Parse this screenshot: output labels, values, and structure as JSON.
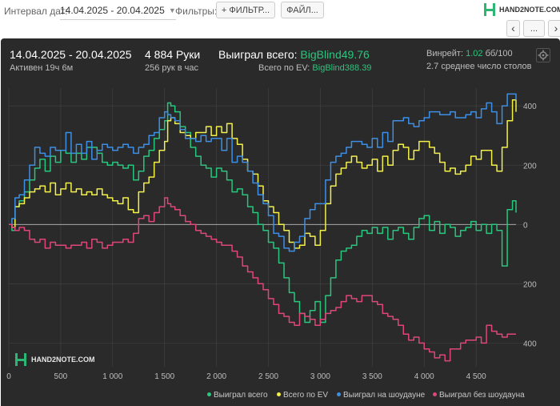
{
  "toolbar": {
    "interval_label": "Интервал дат:",
    "interval_value": "14.04.2025 - 20.04.2025",
    "filters_label": "Фильтры:",
    "filter_button": "+ ФИЛЬТР...",
    "file_button": "ФАЙЛ...",
    "back_button": "‹",
    "more_button": "...",
    "logo_text": "HAND2NOTE.COM"
  },
  "summary": {
    "range": "14.04.2025 - 20.04.2025",
    "active": "Активен 19ч 6м",
    "hands": "4 884 Руки",
    "hands_per_hour": "256 рук в час",
    "won_label": "Выиграл всего:",
    "won_value": "BigBlind49.76",
    "ev_label": "Всего по EV:",
    "ev_value": "BigBlind388.39",
    "winrate_label": "Винрейт:",
    "winrate_value": "1.02",
    "winrate_unit": "бб/100",
    "tables": "2.7 среднее число столов"
  },
  "colors": {
    "won": "#27c77d",
    "ev": "#f3f04a",
    "showdown": "#3d8fe6",
    "non_showdown": "#e0457b",
    "zero_line": "#bbbbbb",
    "grid": "#444444"
  },
  "chart_data": {
    "type": "line",
    "xlabel": "",
    "ylabel": "",
    "xlim": [
      0,
      4884
    ],
    "ylim": [
      -480,
      460
    ],
    "xticks": [
      0,
      500,
      1000,
      1500,
      2000,
      2500,
      3000,
      3500,
      4000,
      4500
    ],
    "xtick_labels": [
      "0",
      "500",
      "1 000",
      "1 500",
      "2 000",
      "2 500",
      "3 000",
      "3 500",
      "4 000",
      "4 500"
    ],
    "yticks": [
      400,
      200,
      0,
      -200,
      -400
    ],
    "ytick_labels": [
      "400",
      "200",
      "0",
      "200",
      "400"
    ],
    "grid": true,
    "legend": "bottom-right",
    "series": [
      {
        "name": "Выиграл всего",
        "key": "won",
        "x": [
          0,
          30,
          60,
          100,
          150,
          200,
          250,
          300,
          350,
          400,
          450,
          500,
          550,
          600,
          650,
          700,
          750,
          800,
          850,
          900,
          950,
          1000,
          1050,
          1100,
          1150,
          1200,
          1250,
          1300,
          1350,
          1400,
          1450,
          1500,
          1530,
          1560,
          1600,
          1650,
          1700,
          1750,
          1800,
          1850,
          1900,
          1950,
          2000,
          2050,
          2100,
          2150,
          2200,
          2250,
          2300,
          2350,
          2400,
          2450,
          2500,
          2550,
          2600,
          2650,
          2700,
          2750,
          2800,
          2850,
          2900,
          2950,
          3000,
          3050,
          3100,
          3150,
          3200,
          3250,
          3300,
          3350,
          3400,
          3450,
          3500,
          3550,
          3600,
          3650,
          3700,
          3750,
          3800,
          3850,
          3900,
          3950,
          4000,
          4050,
          4100,
          4150,
          4200,
          4250,
          4300,
          4350,
          4400,
          4450,
          4500,
          4550,
          4600,
          4650,
          4700,
          4750,
          4800,
          4850,
          4884
        ],
        "y": [
          0,
          -20,
          60,
          80,
          110,
          150,
          190,
          220,
          180,
          230,
          210,
          250,
          240,
          210,
          240,
          220,
          260,
          260,
          240,
          210,
          200,
          210,
          200,
          190,
          200,
          150,
          180,
          230,
          250,
          290,
          320,
          350,
          410,
          400,
          380,
          330,
          310,
          260,
          230,
          200,
          190,
          160,
          190,
          180,
          150,
          110,
          120,
          100,
          60,
          40,
          0,
          -20,
          -60,
          -80,
          -130,
          -180,
          -230,
          -260,
          -300,
          -330,
          -290,
          -260,
          -330,
          -240,
          -180,
          -120,
          -90,
          -80,
          -70,
          -40,
          -20,
          -30,
          -10,
          -30,
          -10,
          -50,
          -20,
          -10,
          -30,
          -50,
          -10,
          20,
          30,
          -20,
          10,
          -30,
          0,
          -10,
          -40,
          -20,
          -10,
          10,
          -20,
          0,
          -30,
          0,
          -20,
          -140,
          50,
          80,
          40
        ]
      },
      {
        "name": "Всего по EV",
        "key": "ev",
        "x": [
          0,
          30,
          60,
          100,
          150,
          200,
          250,
          300,
          350,
          400,
          450,
          500,
          550,
          600,
          650,
          700,
          750,
          800,
          850,
          900,
          950,
          1000,
          1050,
          1100,
          1150,
          1200,
          1250,
          1300,
          1350,
          1400,
          1450,
          1500,
          1530,
          1560,
          1600,
          1650,
          1700,
          1750,
          1800,
          1850,
          1900,
          1950,
          2000,
          2050,
          2100,
          2150,
          2200,
          2250,
          2300,
          2350,
          2400,
          2450,
          2500,
          2550,
          2600,
          2650,
          2700,
          2750,
          2800,
          2850,
          2900,
          2950,
          3000,
          3050,
          3100,
          3150,
          3200,
          3250,
          3300,
          3350,
          3400,
          3450,
          3500,
          3550,
          3600,
          3650,
          3700,
          3750,
          3800,
          3850,
          3900,
          3950,
          4000,
          4050,
          4100,
          4150,
          4200,
          4250,
          4300,
          4350,
          4400,
          4450,
          4500,
          4550,
          4600,
          4650,
          4700,
          4750,
          4800,
          4850,
          4884
        ],
        "y": [
          0,
          -10,
          60,
          70,
          90,
          110,
          120,
          130,
          110,
          140,
          100,
          120,
          140,
          110,
          120,
          100,
          110,
          100,
          120,
          100,
          90,
          80,
          70,
          90,
          50,
          40,
          110,
          140,
          160,
          210,
          250,
          280,
          350,
          360,
          340,
          310,
          300,
          290,
          310,
          310,
          330,
          300,
          330,
          310,
          340,
          290,
          270,
          220,
          180,
          170,
          130,
          80,
          60,
          40,
          0,
          -20,
          -60,
          -80,
          -70,
          -30,
          -40,
          -70,
          -20,
          70,
          130,
          170,
          190,
          210,
          230,
          210,
          190,
          200,
          220,
          180,
          230,
          200,
          250,
          270,
          260,
          220,
          250,
          280,
          280,
          260,
          240,
          210,
          180,
          190,
          170,
          180,
          200,
          230,
          220,
          250,
          250,
          200,
          180,
          260,
          350,
          420,
          380
        ]
      },
      {
        "name": "Выиграл на шоудауне",
        "key": "showdown",
        "x": [
          0,
          30,
          60,
          100,
          150,
          200,
          250,
          300,
          350,
          400,
          450,
          500,
          550,
          600,
          650,
          700,
          750,
          800,
          850,
          900,
          950,
          1000,
          1050,
          1100,
          1150,
          1200,
          1250,
          1300,
          1350,
          1400,
          1450,
          1500,
          1530,
          1560,
          1600,
          1650,
          1700,
          1750,
          1800,
          1850,
          1900,
          1950,
          2000,
          2050,
          2100,
          2150,
          2200,
          2250,
          2300,
          2350,
          2400,
          2450,
          2500,
          2550,
          2600,
          2650,
          2700,
          2750,
          2800,
          2850,
          2900,
          2950,
          3000,
          3050,
          3100,
          3150,
          3200,
          3250,
          3300,
          3350,
          3400,
          3450,
          3500,
          3550,
          3600,
          3650,
          3700,
          3750,
          3800,
          3850,
          3900,
          3950,
          4000,
          4050,
          4100,
          4150,
          4200,
          4250,
          4300,
          4350,
          4400,
          4450,
          4500,
          4550,
          4600,
          4650,
          4700,
          4750,
          4800,
          4850,
          4884
        ],
        "y": [
          0,
          20,
          90,
          100,
          150,
          200,
          260,
          240,
          230,
          260,
          250,
          250,
          310,
          240,
          270,
          240,
          280,
          220,
          250,
          270,
          260,
          250,
          260,
          270,
          260,
          240,
          260,
          270,
          300,
          310,
          360,
          380,
          370,
          360,
          350,
          320,
          290,
          290,
          280,
          300,
          280,
          290,
          290,
          250,
          290,
          210,
          230,
          210,
          180,
          140,
          100,
          70,
          30,
          -30,
          -40,
          -80,
          -90,
          -60,
          -40,
          20,
          50,
          70,
          70,
          150,
          210,
          230,
          240,
          260,
          280,
          280,
          270,
          260,
          290,
          260,
          310,
          280,
          350,
          350,
          360,
          340,
          330,
          350,
          360,
          380,
          380,
          370,
          370,
          380,
          360,
          360,
          370,
          380,
          360,
          390,
          410,
          380,
          340,
          400,
          440,
          440,
          420
        ]
      },
      {
        "name": "Выиграл без шоудауна",
        "key": "non_showdown",
        "x": [
          0,
          30,
          60,
          100,
          150,
          200,
          250,
          300,
          350,
          400,
          450,
          500,
          550,
          600,
          650,
          700,
          750,
          800,
          850,
          900,
          950,
          1000,
          1050,
          1100,
          1150,
          1200,
          1250,
          1300,
          1350,
          1400,
          1450,
          1500,
          1530,
          1560,
          1600,
          1650,
          1700,
          1750,
          1800,
          1850,
          1900,
          1950,
          2000,
          2050,
          2100,
          2150,
          2200,
          2250,
          2300,
          2350,
          2400,
          2450,
          2500,
          2550,
          2600,
          2650,
          2700,
          2750,
          2800,
          2850,
          2900,
          2950,
          3000,
          3050,
          3100,
          3150,
          3200,
          3250,
          3300,
          3350,
          3400,
          3450,
          3500,
          3550,
          3600,
          3650,
          3700,
          3750,
          3800,
          3850,
          3900,
          3950,
          4000,
          4050,
          4100,
          4150,
          4200,
          4250,
          4300,
          4350,
          4400,
          4450,
          4500,
          4550,
          4600,
          4650,
          4700,
          4750,
          4800,
          4850,
          4884
        ],
        "y": [
          0,
          -10,
          -20,
          -10,
          -20,
          -50,
          -60,
          -50,
          -80,
          -60,
          -70,
          -70,
          -80,
          -70,
          -70,
          -60,
          -80,
          -50,
          -60,
          -80,
          -70,
          -60,
          -60,
          -50,
          -60,
          -30,
          20,
          30,
          10,
          40,
          60,
          90,
          70,
          60,
          50,
          30,
          10,
          0,
          -20,
          -30,
          -40,
          -50,
          -60,
          -70,
          -70,
          -90,
          -110,
          -140,
          -160,
          -180,
          -200,
          -220,
          -250,
          -270,
          -300,
          -310,
          -330,
          -340,
          -300,
          -310,
          -320,
          -340,
          -320,
          -300,
          -290,
          -280,
          -260,
          -240,
          -250,
          -260,
          -240,
          -240,
          -260,
          -270,
          -300,
          -310,
          -320,
          -340,
          -370,
          -390,
          -380,
          -400,
          -420,
          -430,
          -450,
          -440,
          -460,
          -420,
          -420,
          -400,
          -390,
          -390,
          -380,
          -400,
          -340,
          -360,
          -370,
          -380,
          -370,
          -370,
          -370
        ]
      }
    ]
  },
  "legend": [
    {
      "label": "Выиграл всего",
      "key": "won"
    },
    {
      "label": "Всего по EV",
      "key": "ev"
    },
    {
      "label": "Выиграл на шоудауне",
      "key": "showdown"
    },
    {
      "label": "Выиграл без шоудауна",
      "key": "non_showdown"
    }
  ],
  "watermark": "HAND2NOTE.COM"
}
